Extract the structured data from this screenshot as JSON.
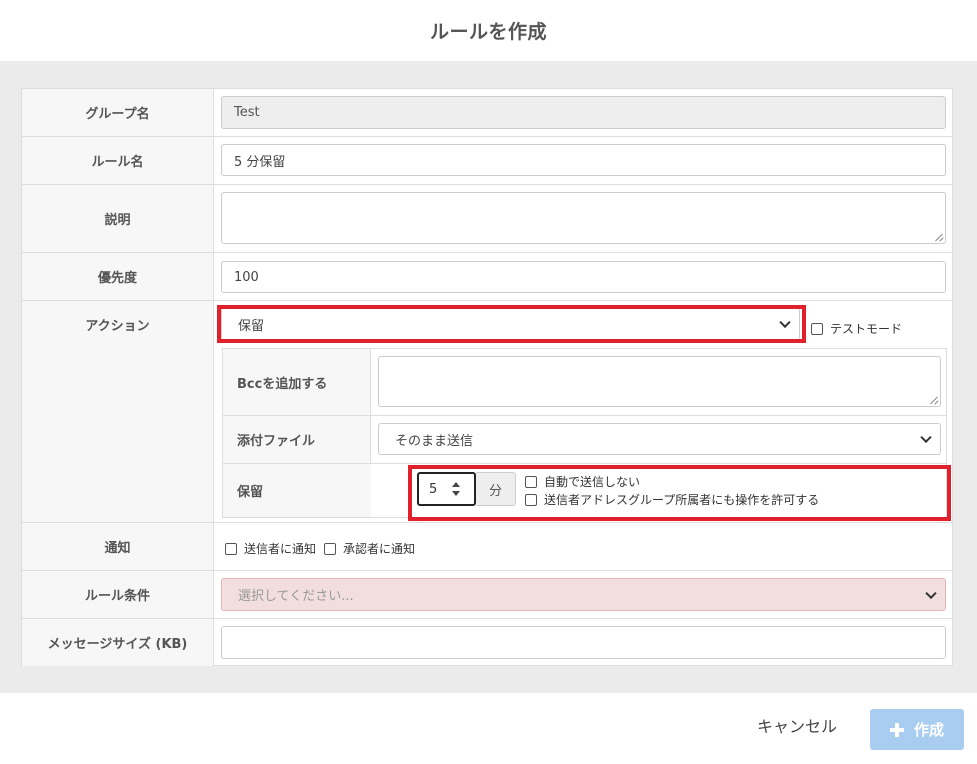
{
  "dialog": {
    "title": "ルールを作成"
  },
  "form": {
    "group_name": {
      "label": "グループ名",
      "value": "Test"
    },
    "rule_name": {
      "label": "ルール名",
      "value": "5 分保留"
    },
    "description": {
      "label": "説明",
      "value": ""
    },
    "priority": {
      "label": "優先度",
      "value": "100"
    },
    "action": {
      "label": "アクション",
      "selected": "保留",
      "test_mode_label": "テストモード",
      "test_mode_checked": false,
      "bcc": {
        "label": "Bccを追加する",
        "value": ""
      },
      "attachment": {
        "label": "添付ファイル",
        "selected": "そのまま送信"
      },
      "hold": {
        "label": "保留",
        "minutes": "5",
        "unit": "分",
        "no_auto_send_label": "自動で送信しない",
        "no_auto_send_checked": false,
        "allow_sender_group_label": "送信者アドレスグループ所属者にも操作を許可する",
        "allow_sender_group_checked": false
      }
    },
    "notification": {
      "label": "通知",
      "notify_sender_label": "送信者に通知",
      "notify_sender_checked": false,
      "notify_approver_label": "承認者に通知",
      "notify_approver_checked": false
    },
    "rule_condition": {
      "label": "ルール条件",
      "placeholder": "選択してください..."
    },
    "message_size": {
      "label": "メッセージサイズ (KB)",
      "value": ""
    }
  },
  "footer": {
    "cancel_label": "キャンセル",
    "create_label": "作成"
  },
  "colors": {
    "highlight": "#e0202a",
    "create_button_bg": "#a9cdf0",
    "condition_select_bg": "#f2dede"
  }
}
